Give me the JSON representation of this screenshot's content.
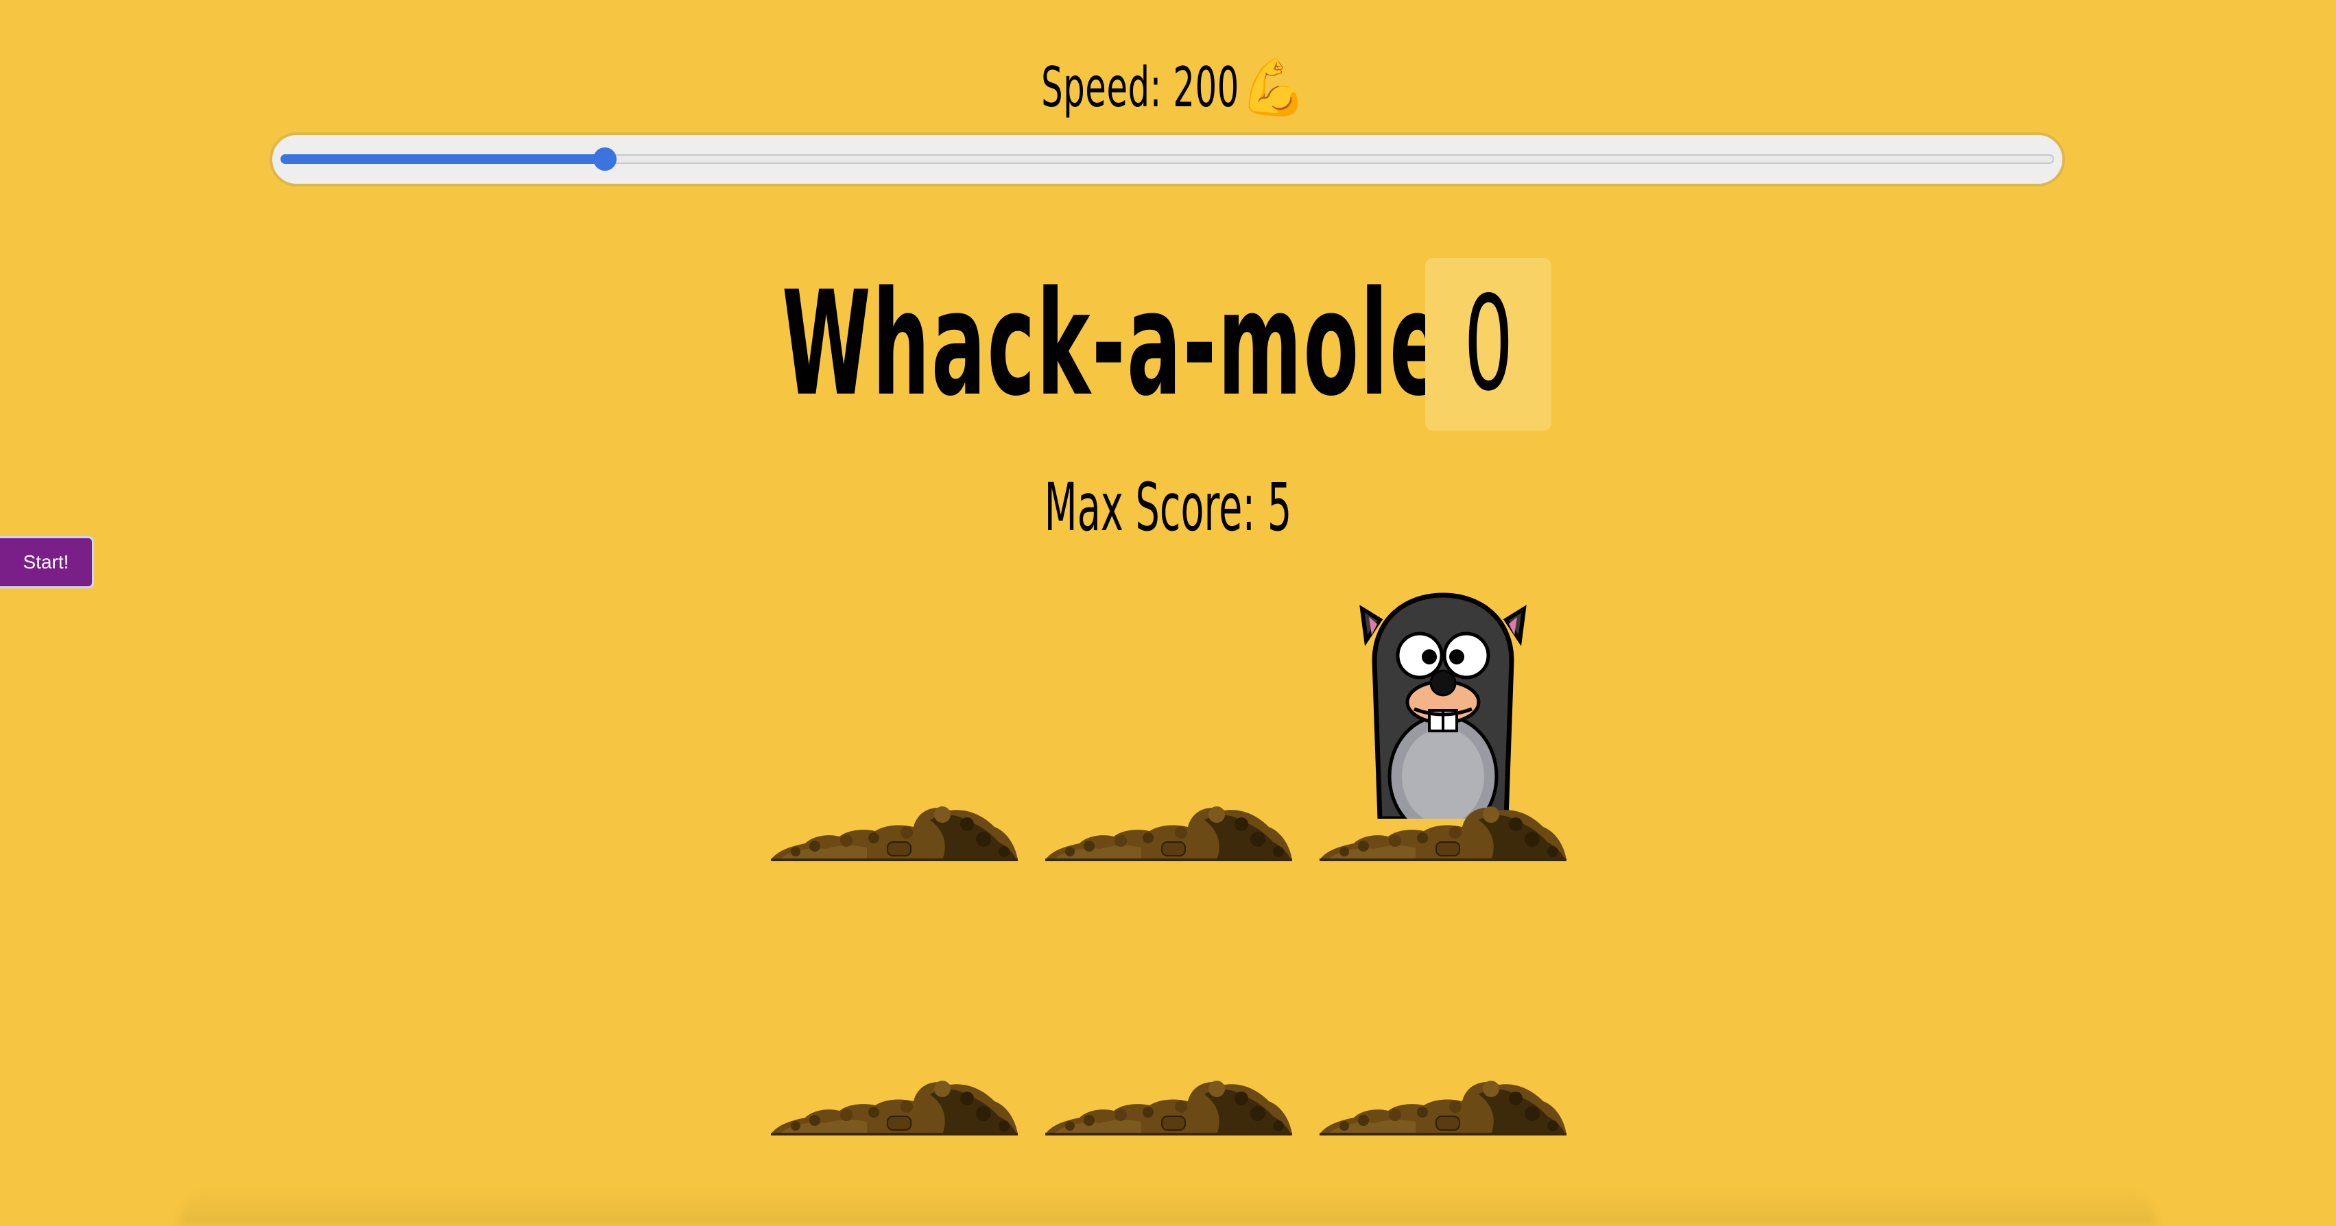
{
  "speed": {
    "label": "Speed: 200",
    "value": 200,
    "icon": "flexed-biceps-icon",
    "slider_fraction": 0.183
  },
  "game": {
    "title": "Whack-a-mole!",
    "score": "0",
    "max_score_label": "Max Score: 5"
  },
  "controls": {
    "start_label": "Start!"
  },
  "holes": [
    {
      "id": "hole-1",
      "has_mole": false
    },
    {
      "id": "hole-2",
      "has_mole": false
    },
    {
      "id": "hole-3",
      "has_mole": true
    },
    {
      "id": "hole-4",
      "has_mole": false
    },
    {
      "id": "hole-5",
      "has_mole": false
    },
    {
      "id": "hole-6",
      "has_mole": false
    }
  ],
  "colors": {
    "background": "#f6c642",
    "slider_accent": "#3b73e0",
    "start_button": "#7a1e88",
    "score_box": "#f8d264"
  }
}
